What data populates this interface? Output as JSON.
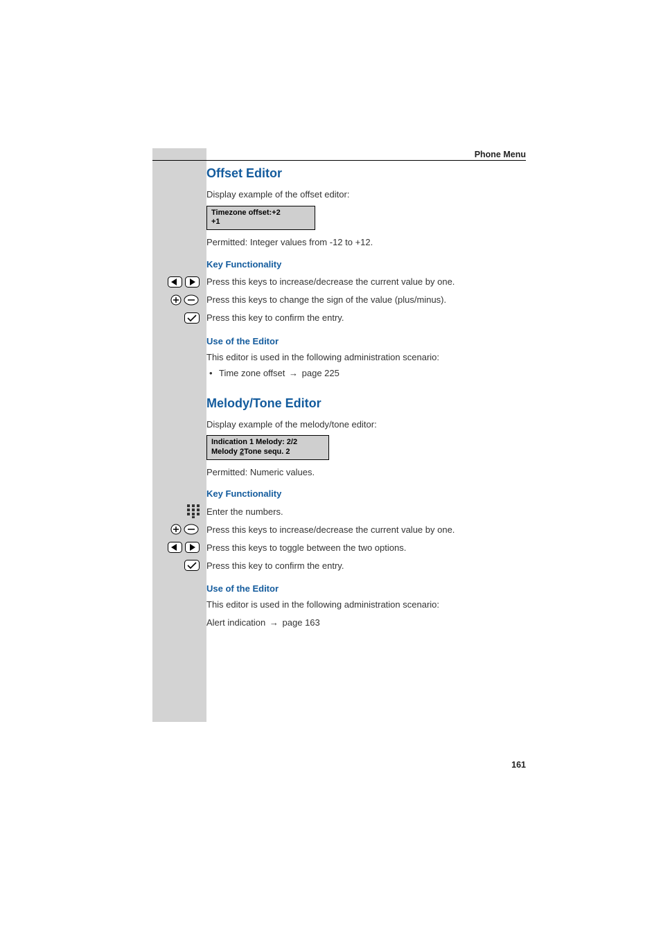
{
  "header": {
    "section_title": "Phone Menu"
  },
  "page_number": "161",
  "editor1": {
    "heading": "Offset Editor",
    "intro": "Display example of the offset editor:",
    "display_line1": "Timezone offset:+2",
    "display_line2": "+1",
    "permitted": "Permitted: Integer values from -12 to +12.",
    "key_func_heading": "Key Functionality",
    "keyrow_leftright": "Press this keys to increase/decrease the current value by one.",
    "keyrow_plusminus": "Press this keys to change the sign of the value (plus/minus).",
    "keyrow_confirm": "Press this key to confirm the entry.",
    "use_heading": "Use of the Editor",
    "use_intro": "This editor is used in the following administration scenario:",
    "bullet_label": "Time zone offset",
    "bullet_pageref": "page 225"
  },
  "editor2": {
    "heading": "Melody/Tone Editor",
    "intro": "Display example of the melody/tone editor:",
    "display_line1": "Indication 1 Melody: 2/2",
    "display_line2_prefix": "Melody ",
    "display_line2_underline": "2",
    "display_line2_suffix": "Tone sequ. 2",
    "permitted": "Permitted: Numeric values.",
    "key_func_heading": "Key Functionality",
    "keyrow_keypad": "Enter the numbers.",
    "keyrow_plusminus": "Press this keys to increase/decrease the current value by one.",
    "keyrow_leftright": "Press this keys to toggle between the two options.",
    "keyrow_confirm": "Press this key to confirm the entry.",
    "use_heading": "Use of the Editor",
    "use_intro": "This editor is used in the following administration scenario:",
    "alert_label": "Alert indication",
    "alert_pageref": "page 163"
  }
}
